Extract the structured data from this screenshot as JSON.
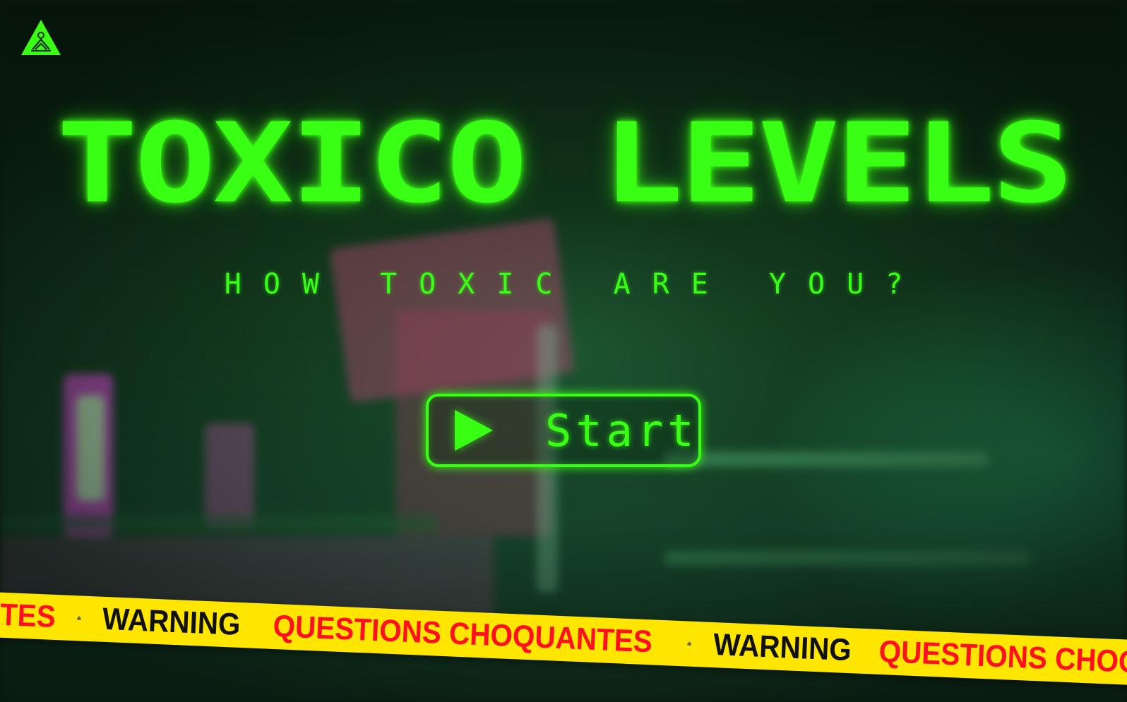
{
  "game": {
    "title": "TOXICO LEVELS",
    "subtitle": "HOW TOXIC ARE YOU?",
    "start_label": "Start"
  },
  "warning_tape": {
    "leading_fragment": "TES",
    "items": [
      {
        "warning": "WARNING",
        "text": "QUESTIONS CHOQUANTES"
      },
      {
        "warning": "WARNING",
        "text": "QUESTIONS CHOQ"
      }
    ]
  },
  "icons": {
    "logo": "biohazard-triangle-icon",
    "play": "play-icon",
    "tape": "biohazard-icon"
  },
  "colors": {
    "neon_green": "#39ff14",
    "tape_yellow": "#ffe600",
    "tape_red": "#ff1020",
    "background": "#0f2a16"
  }
}
